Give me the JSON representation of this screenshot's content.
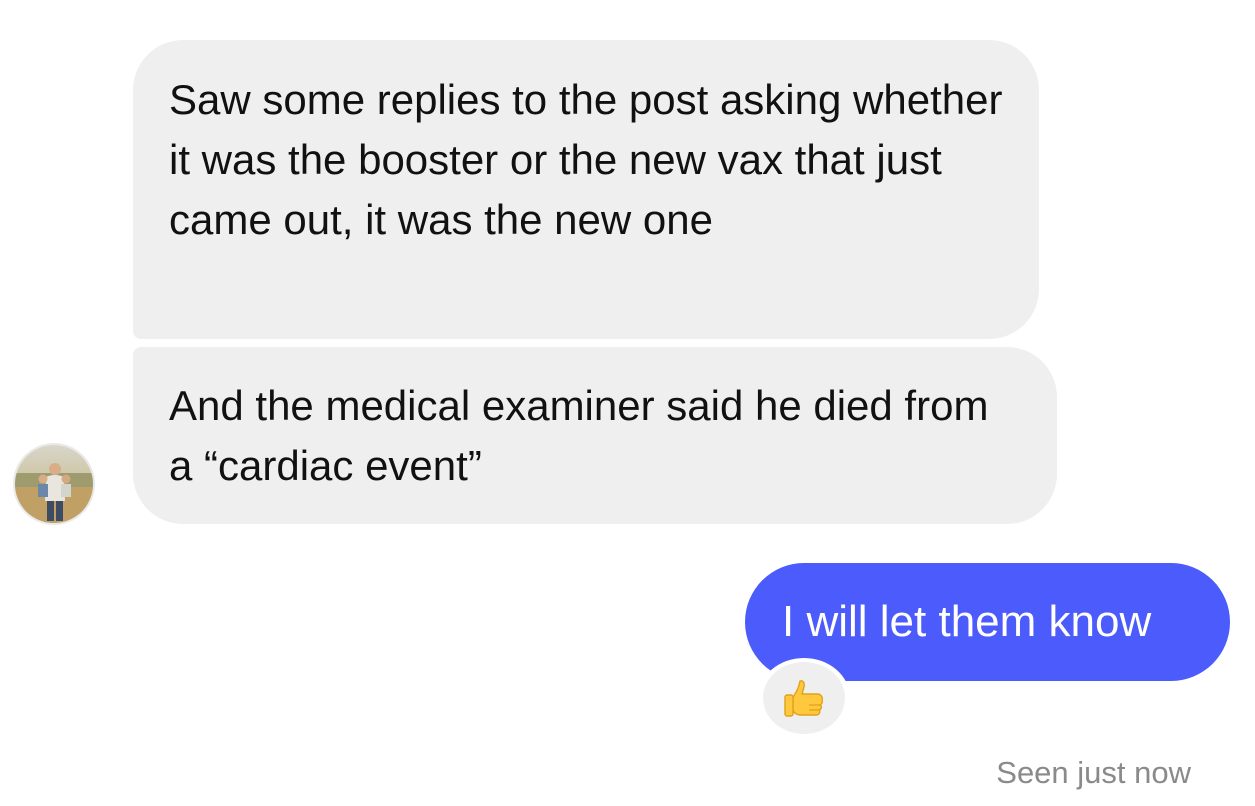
{
  "messages": {
    "incoming": [
      {
        "text": "Saw some replies to the post asking whether it was the booster or the new vax that just came out, it was the new one"
      },
      {
        "text": "And the medical examiner said he died from a “cardiac event”"
      }
    ],
    "outgoing": [
      {
        "text": "I will let them know",
        "reaction": "thumbs-up-icon"
      }
    ]
  },
  "status": {
    "seen_label": "Seen just now"
  },
  "colors": {
    "incoming_bubble": "#efefef",
    "outgoing_bubble": "#4c5bfb",
    "reaction_emoji": "#ffc83d",
    "status_text": "#8a8a8a"
  }
}
